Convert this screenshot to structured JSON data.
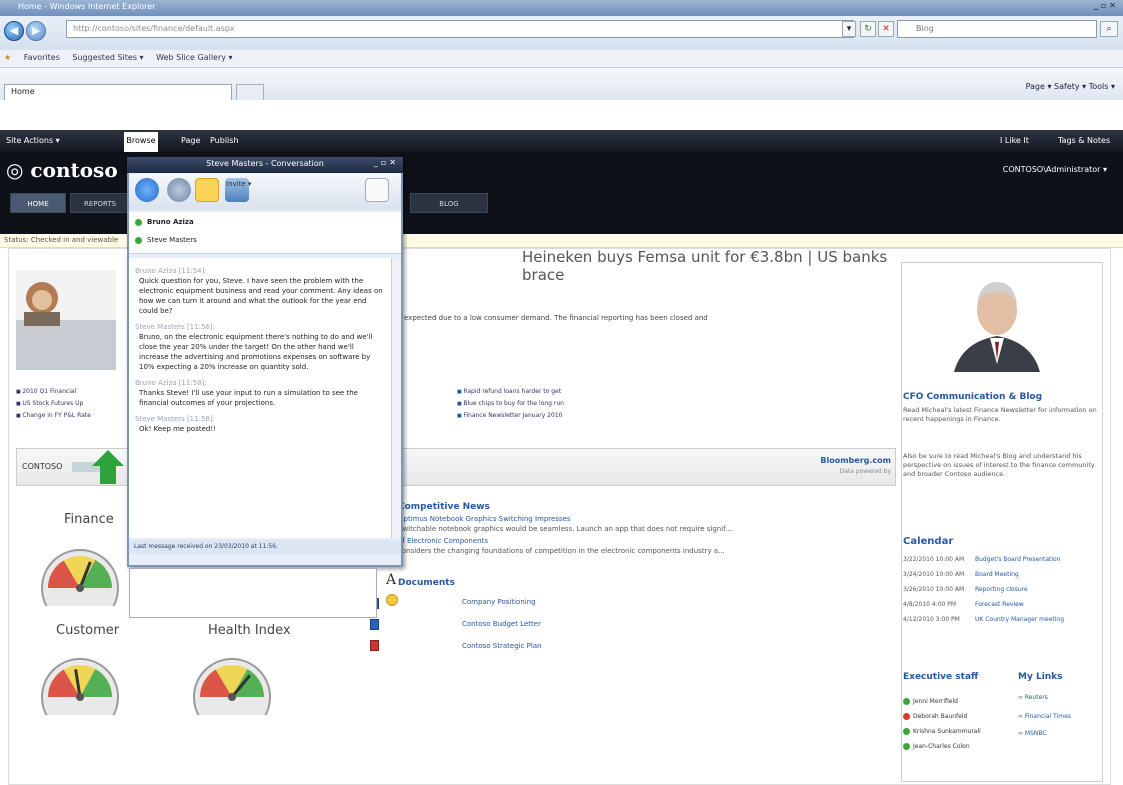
{
  "browser": {
    "title": "Home - Windows Internet Explorer",
    "address": "http://contoso/sites/finance/default.aspx",
    "search_placeholder": "Bing",
    "favorites": {
      "label": "Favorites",
      "suggested": "Suggested Sites ▾",
      "gallery": "Web Slice Gallery ▾"
    },
    "tab": "Home",
    "commands": "Page ▾  Safety ▾  Tools ▾"
  },
  "sharepoint": {
    "ribbon": {
      "site_actions": "Site Actions ▾",
      "browse": "Browse",
      "page": "Page",
      "publish": "Publish",
      "i_like_it": "I Like It",
      "tags_notes": "Tags & Notes"
    },
    "logo": "contoso",
    "user": "CONTOSO\\Administrator ▾",
    "nav": [
      "HOME",
      "REPORTS",
      "BLOG"
    ],
    "status": "Status: Checked in and viewable"
  },
  "main": {
    "headline": "Heineken buys Femsa unit for €3.8bn | US banks brace",
    "summary": "expected due to a low consumer demand. The financial reporting has been closed and",
    "left_links": [
      "2010 Q1 Financial",
      "US Stock Futures Up",
      "Change in FY P&L Rate"
    ],
    "rss_links": [
      "Rapid refund loans harder to get",
      "Blue chips to buy for the long run",
      "Finance Newsletter January 2010"
    ],
    "stock_label": "CONTOSO",
    "bloomberg": "Bloomberg.com",
    "bloomberg_sub": "Data powered by",
    "gauges": [
      {
        "title": "Finance",
        "level": 0.62
      },
      {
        "title": "Customer",
        "level": 0.45
      },
      {
        "title": "Health Index",
        "level": 0.72
      }
    ],
    "competitive": {
      "title": "Competitive News",
      "items": [
        "Optimus Notebook Graphics Switching Impresses",
        "Switchable notebook graphics would be seamless. Launch an app that does not require signif...",
        "of Electronic Components",
        "considers the changing foundations of competition in the electronic components industry a..."
      ]
    },
    "documents": {
      "title": "Documents",
      "items": [
        "Company Positioning",
        "Contoso Budget Letter",
        "Contoso Strategic Plan"
      ]
    }
  },
  "right": {
    "cfo_title": "CFO Communication & Blog",
    "cfo_text1": "Read Micheal's latest Finance Newsletter for information on recent happenings in Finance.",
    "cfo_text2": "Also be sure to read Micheal's Blog and understand his perspective on issues of interest to the finance community and broader Contoso audience.",
    "calendar_title": "Calendar",
    "calendar": [
      {
        "date": "3/22/2010 10:00 AM",
        "event": "Budget's Board Presentation"
      },
      {
        "date": "3/24/2010 10:00 AM",
        "event": "Board Meeting"
      },
      {
        "date": "3/26/2010 10:00 AM",
        "event": "Reporting closure"
      },
      {
        "date": "4/8/2010 4:00 PM",
        "event": "Forecast Review"
      },
      {
        "date": "4/12/2010 3:00 PM",
        "event": "UK Country Manager meeting"
      }
    ],
    "exec_title": "Executive staff",
    "staff": [
      {
        "name": "Jenni Merrifield",
        "status": "#3aa63a"
      },
      {
        "name": "Deborah Baunfeld",
        "status": "#d83b2b"
      },
      {
        "name": "Krishna Sunkammurali",
        "status": "#3aa63a"
      },
      {
        "name": "Jean-Charles Colon",
        "status": "#3aa63a"
      }
    ],
    "mylinks_title": "My Links",
    "mylinks": [
      "Reuters",
      "Financial Times",
      "MSNBC"
    ]
  },
  "conversation": {
    "title": "Steve Masters - Conversation",
    "invite": "Invite ▾",
    "participants": [
      "Bruno Aziza",
      "Steve Masters"
    ],
    "messages": [
      {
        "from": "Bruno Aziza [11:54]:",
        "text": "Quick question for you, Steve.  I have seen the problem with the electronic equipment business and read your comment. Any ideas on how we can turn it around and what the outlook for the year end could be?"
      },
      {
        "from": "Steve Masters [11:56]:",
        "text": "Bruno, on the electronic equipment there's nothing to do and we'll close the year 20% under the target! On the other hand we'll increase the advertising and promotions expenses on software by 10% expecting a 20% increase on quantity sold."
      },
      {
        "from": "Bruno Aziza [11:58]:",
        "text": "Thanks Steve! I'll use your input to run a simulation to see the financial outcomes of your projections."
      },
      {
        "from": "Steve Masters [11:58]:",
        "text": "Ok! Keep me posted!!"
      }
    ],
    "last_message": "Last message received on 23/03/2010 at 11:56.",
    "font_glyph": "A"
  }
}
